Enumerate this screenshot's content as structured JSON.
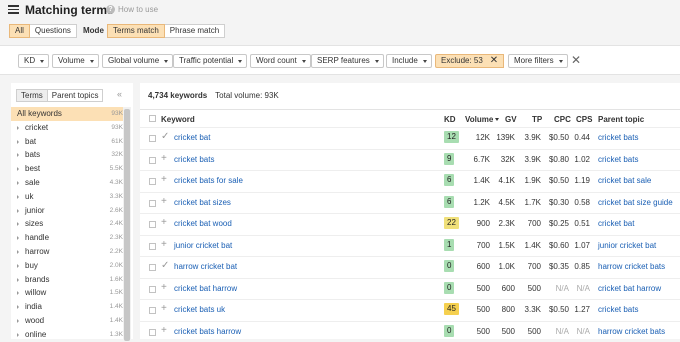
{
  "header": {
    "title": "Matching terms",
    "help_text": "How to use"
  },
  "scope_toggle": {
    "options": [
      "All",
      "Questions"
    ]
  },
  "mode": {
    "label": "Mode",
    "options": [
      "Terms match",
      "Phrase match"
    ]
  },
  "filters": {
    "items": [
      "KD",
      "Volume",
      "Global volume",
      "Traffic potential",
      "Word count",
      "SERP features",
      "Include"
    ],
    "exclude_label": "Exclude: 53",
    "more_filters": "More filters"
  },
  "sidebar": {
    "tabs": [
      "Terms",
      "Parent topics"
    ],
    "items": [
      {
        "label": "All keywords",
        "count": "93K"
      },
      {
        "label": "cricket",
        "count": "93K"
      },
      {
        "label": "bat",
        "count": "61K"
      },
      {
        "label": "bats",
        "count": "32K"
      },
      {
        "label": "best",
        "count": "5.5K"
      },
      {
        "label": "sale",
        "count": "4.3K"
      },
      {
        "label": "uk",
        "count": "3.3K"
      },
      {
        "label": "junior",
        "count": "2.6K"
      },
      {
        "label": "sizes",
        "count": "2.4K"
      },
      {
        "label": "handle",
        "count": "2.3K"
      },
      {
        "label": "harrow",
        "count": "2.2K"
      },
      {
        "label": "buy",
        "count": "2.0K"
      },
      {
        "label": "brands",
        "count": "1.6K"
      },
      {
        "label": "willow",
        "count": "1.5K"
      },
      {
        "label": "india",
        "count": "1.4K"
      },
      {
        "label": "wood",
        "count": "1.4K"
      },
      {
        "label": "online",
        "count": "1.3K"
      }
    ]
  },
  "summary": {
    "count": "4,734 keywords",
    "volume": "Total volume: 93K"
  },
  "table": {
    "columns": [
      "Keyword",
      "KD",
      "Volume",
      "GV",
      "TP",
      "CPC",
      "CPS",
      "Parent topic"
    ],
    "rows": [
      {
        "icon": "check",
        "keyword": "cricket bat",
        "kd": "12",
        "kd_color": "#a8ddb1",
        "volume": "12K",
        "gv": "139K",
        "tp": "3.9K",
        "cpc": "$0.50",
        "cps": "0.44",
        "parent": "cricket bats"
      },
      {
        "icon": "plus",
        "keyword": "cricket bats",
        "kd": "9",
        "kd_color": "#a8ddb1",
        "volume": "6.7K",
        "gv": "32K",
        "tp": "3.9K",
        "cpc": "$0.80",
        "cps": "1.02",
        "parent": "cricket bats"
      },
      {
        "icon": "plus",
        "keyword": "cricket bats for sale",
        "kd": "6",
        "kd_color": "#a8ddb1",
        "volume": "1.4K",
        "gv": "4.1K",
        "tp": "1.9K",
        "cpc": "$0.50",
        "cps": "1.19",
        "parent": "cricket bat sale"
      },
      {
        "icon": "plus",
        "keyword": "cricket bat sizes",
        "kd": "6",
        "kd_color": "#a8ddb1",
        "volume": "1.2K",
        "gv": "4.5K",
        "tp": "1.7K",
        "cpc": "$0.30",
        "cps": "0.58",
        "parent": "cricket bat size guide"
      },
      {
        "icon": "plus",
        "keyword": "cricket bat wood",
        "kd": "22",
        "kd_color": "#f0e07a",
        "volume": "900",
        "gv": "2.3K",
        "tp": "700",
        "cpc": "$0.25",
        "cps": "0.51",
        "parent": "cricket bat"
      },
      {
        "icon": "plus",
        "keyword": "junior cricket bat",
        "kd": "1",
        "kd_color": "#a8ddb1",
        "volume": "700",
        "gv": "1.5K",
        "tp": "1.4K",
        "cpc": "$0.60",
        "cps": "1.07",
        "parent": "junior cricket bat"
      },
      {
        "icon": "check",
        "keyword": "harrow cricket bat",
        "kd": "0",
        "kd_color": "#a8ddb1",
        "volume": "600",
        "gv": "1.0K",
        "tp": "700",
        "cpc": "$0.35",
        "cps": "0.85",
        "parent": "harrow cricket bats"
      },
      {
        "icon": "plus",
        "keyword": "cricket bat harrow",
        "kd": "0",
        "kd_color": "#a8ddb1",
        "volume": "500",
        "gv": "600",
        "tp": "500",
        "cpc": "N/A",
        "cps": "N/A",
        "parent": "cricket bat harrow"
      },
      {
        "icon": "plus",
        "keyword": "cricket bats uk",
        "kd": "45",
        "kd_color": "#f5d04f",
        "volume": "500",
        "gv": "800",
        "tp": "3.3K",
        "cpc": "$0.50",
        "cps": "1.27",
        "parent": "cricket bats"
      },
      {
        "icon": "plus",
        "keyword": "cricket bats harrow",
        "kd": "0",
        "kd_color": "#a8ddb1",
        "volume": "500",
        "gv": "500",
        "tp": "500",
        "cpc": "N/A",
        "cps": "N/A",
        "parent": "harrow cricket bats"
      }
    ]
  }
}
